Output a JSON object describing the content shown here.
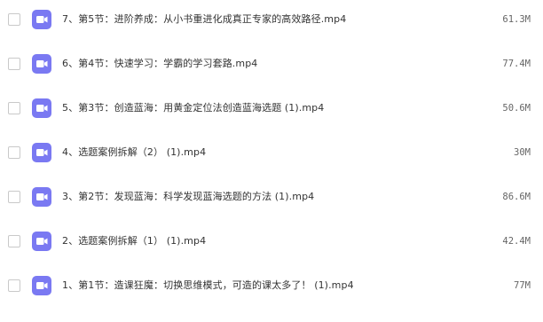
{
  "files": [
    {
      "name": "7、第5节：进阶养成：从小书重进化成真正专家的高效路径.mp4",
      "size": "61.3M"
    },
    {
      "name": "6、第4节：快速学习：学霸的学习套路.mp4",
      "size": "77.4M"
    },
    {
      "name": "5、第3节：创造蓝海：用黄金定位法创造蓝海选题 (1).mp4",
      "size": "50.6M"
    },
    {
      "name": "4、选题案例拆解（2） (1).mp4",
      "size": "30M"
    },
    {
      "name": "3、第2节：发现蓝海：科学发现蓝海选题的方法 (1).mp4",
      "size": "86.6M"
    },
    {
      "name": "2、选题案例拆解（1） (1).mp4",
      "size": "42.4M"
    },
    {
      "name": "1、第1节：造课狂魔：切换思维模式，可造的课太多了！ (1).mp4",
      "size": "77M"
    }
  ],
  "icons": {
    "file_icon": "video-file-icon",
    "file_icon_color": "#7a79f2"
  }
}
